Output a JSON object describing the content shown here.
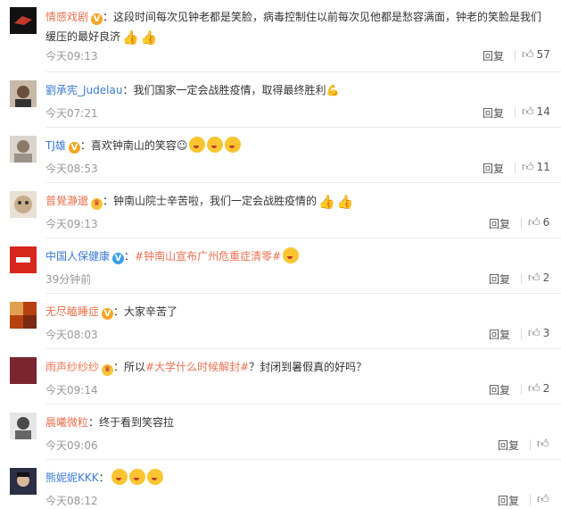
{
  "comments": [
    {
      "user": "情感戏剧",
      "text": "这段时间每次见钟老都是笑脸，病毒控制住以前每次见他都是愁容满面，钟老的笑脸是我们缓压的最好良济",
      "time": "今天09:13",
      "reply": "回复",
      "likes": "57"
    },
    {
      "user": "劉承宪_Judelau",
      "text": "我们国家一定会战胜疫情，取得最终胜利",
      "time": "今天07:21",
      "reply": "回复",
      "likes": "14"
    },
    {
      "user": "TJ雄",
      "text": "喜欢钟南山的笑容",
      "time": "今天08:53",
      "reply": "回复",
      "likes": "11"
    },
    {
      "user": "普覺瀞邈",
      "text": "钟南山院士辛苦啦，我们一定会战胜疫情的",
      "time": "今天09:13",
      "reply": "回复",
      "likes": "6"
    },
    {
      "user": "中国人保健康",
      "tag": "#钟南山宣布广州危重症清零#",
      "time": "39分钟前",
      "reply": "回复",
      "likes": "2"
    },
    {
      "user": "无尽瞌睡症",
      "text": "大家辛苦了",
      "time": "今天08:03",
      "reply": "回复",
      "likes": "3"
    },
    {
      "user": "雨声纱纱纱",
      "text_pre": "所以",
      "tag": "#大学什么时候解封#",
      "text_post": "？封闭到暑假真的好吗？",
      "time": "今天09:14",
      "reply": "回复",
      "likes": "2"
    },
    {
      "user": "晨曦微粒",
      "text": "终于看到笑容拉",
      "time": "今天09:06",
      "reply": "回复"
    },
    {
      "user": "熊妮妮KKK",
      "time": "今天08:12",
      "reply": "回复"
    }
  ],
  "colors": {
    "username": "#eb7350",
    "username_brand": "#3a7bd5",
    "vip_badge": "#f5a623",
    "verified_badge": "#3aa0f0",
    "meta": "#999999"
  },
  "icons": {
    "like": "thumb-up-outline-icon",
    "vip": "v-badge-icon",
    "member": "crown-badge-icon"
  }
}
